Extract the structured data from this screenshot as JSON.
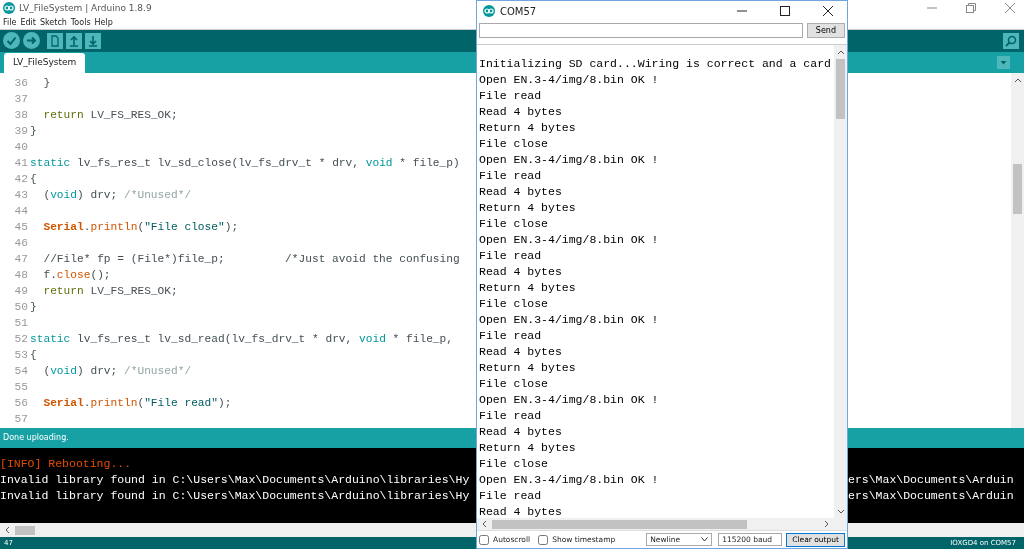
{
  "main_window": {
    "title": "LV_FileSystem | Arduino 1.8.9",
    "menu": [
      "File",
      "Edit",
      "Sketch",
      "Tools",
      "Help"
    ],
    "tabs": [
      {
        "label": "LV_FileSystem",
        "selected": true
      }
    ],
    "editor": {
      "lines": [
        {
          "number": "36",
          "tokens": [
            {
              "text": "  }",
              "kind": "plain"
            }
          ]
        },
        {
          "number": "37"
        },
        {
          "number": "38",
          "tokens": [
            {
              "text": "  return",
              "kind": "return"
            },
            {
              "text": " LV_FS_RES_OK;",
              "kind": "plain"
            }
          ]
        },
        {
          "number": "39",
          "tokens": [
            {
              "text": "}",
              "kind": "plain"
            }
          ]
        },
        {
          "number": "40"
        },
        {
          "number": "41",
          "tokens": [
            {
              "text": "static",
              "kind": "keyword"
            },
            {
              "text": " lv_fs_res_t lv_sd_close(lv_fs_drv_t * drv, ",
              "kind": "plain"
            },
            {
              "text": "void",
              "kind": "keyword"
            },
            {
              "text": " * file_p)",
              "kind": "plain"
            }
          ]
        },
        {
          "number": "42",
          "tokens": [
            {
              "text": "{",
              "kind": "plain"
            }
          ]
        },
        {
          "number": "43",
          "tokens": [
            {
              "text": "  (",
              "kind": "plain"
            },
            {
              "text": "void",
              "kind": "keyword"
            },
            {
              "text": ") drv; ",
              "kind": "plain"
            },
            {
              "text": "/*Unused*/",
              "kind": "comment"
            }
          ]
        },
        {
          "number": "44"
        },
        {
          "number": "45",
          "tokens": [
            {
              "text": "  Serial",
              "kind": "class"
            },
            {
              "text": ".",
              "kind": "plain"
            },
            {
              "text": "println",
              "kind": "method"
            },
            {
              "text": "(",
              "kind": "plain"
            },
            {
              "text": "\"File close\"",
              "kind": "string"
            },
            {
              "text": ");",
              "kind": "plain"
            }
          ]
        },
        {
          "number": "46"
        },
        {
          "number": "47",
          "tokens": [
            {
              "text": "  //File* fp = (File*)file_p;         /*Just avoid the confusing",
              "kind": "plain"
            }
          ]
        },
        {
          "number": "48",
          "tokens": [
            {
              "text": "  f.",
              "kind": "plain"
            },
            {
              "text": "close",
              "kind": "method"
            },
            {
              "text": "();",
              "kind": "plain"
            }
          ]
        },
        {
          "number": "49",
          "tokens": [
            {
              "text": "  return",
              "kind": "return"
            },
            {
              "text": " LV_FS_RES_OK;",
              "kind": "plain"
            }
          ]
        },
        {
          "number": "50",
          "tokens": [
            {
              "text": "}",
              "kind": "plain"
            }
          ]
        },
        {
          "number": "51"
        },
        {
          "number": "52",
          "tokens": [
            {
              "text": "static",
              "kind": "keyword"
            },
            {
              "text": " lv_fs_res_t lv_sd_read(lv_fs_drv_t * drv, ",
              "kind": "plain"
            },
            {
              "text": "void",
              "kind": "keyword"
            },
            {
              "text": " * file_p,",
              "kind": "plain"
            }
          ]
        },
        {
          "number": "53",
          "tokens": [
            {
              "text": "{",
              "kind": "plain"
            }
          ]
        },
        {
          "number": "54",
          "tokens": [
            {
              "text": "  (",
              "kind": "plain"
            },
            {
              "text": "void",
              "kind": "keyword"
            },
            {
              "text": ") drv; ",
              "kind": "plain"
            },
            {
              "text": "/*Unused*/",
              "kind": "comment"
            }
          ]
        },
        {
          "number": "55"
        },
        {
          "number": "56",
          "tokens": [
            {
              "text": "  Serial",
              "kind": "class"
            },
            {
              "text": ".",
              "kind": "plain"
            },
            {
              "text": "println",
              "kind": "method"
            },
            {
              "text": "(",
              "kind": "plain"
            },
            {
              "text": "\"File read\"",
              "kind": "string"
            },
            {
              "text": ");",
              "kind": "plain"
            }
          ]
        },
        {
          "number": "57"
        }
      ]
    },
    "status_message": "Done uploading.",
    "console": {
      "lines": [
        {
          "kind": "info",
          "text": "[INFO] Rebooting..."
        },
        {
          "kind": "normal",
          "text": "Invalid library found in C:\\Users\\Max\\Documents\\Arduino\\libraries\\Hy",
          "tail": "ers\\Max\\Documents\\Arduin"
        },
        {
          "kind": "normal",
          "text": "Invalid library found in C:\\Users\\Max\\Documents\\Arduino\\libraries\\Hy",
          "tail": "ers\\Max\\Documents\\Arduin"
        }
      ]
    },
    "status_bar": {
      "line": "47",
      "board": "IOXGD4 on COM57"
    }
  },
  "serial_monitor": {
    "title": "COM57",
    "send_label": "Send",
    "output": [
      "Initializing SD card...Wiring is correct and a card",
      "Open EN.3-4/img/8.bin OK !",
      "File read",
      "Read 4 bytes",
      "Return 4 bytes",
      "File close",
      "Open EN.3-4/img/8.bin OK !",
      "File read",
      "Read 4 bytes",
      "Return 4 bytes",
      "File close",
      "Open EN.3-4/img/8.bin OK !",
      "File read",
      "Read 4 bytes",
      "Return 4 bytes",
      "File close",
      "Open EN.3-4/img/8.bin OK !",
      "File read",
      "Read 4 bytes",
      "Return 4 bytes",
      "File close",
      "Open EN.3-4/img/8.bin OK !",
      "File read",
      "Read 4 bytes",
      "Return 4 bytes",
      "File close",
      "Open EN.3-4/img/8.bin OK !",
      "File read",
      "Read 4 bytes"
    ],
    "autoscroll": {
      "label": "Autoscroll",
      "checked": false
    },
    "timestamp": {
      "label": "Show timestamp",
      "checked": false
    },
    "line_ending": "Newline",
    "baud": "115200 baud",
    "clear_label": "Clear output"
  }
}
